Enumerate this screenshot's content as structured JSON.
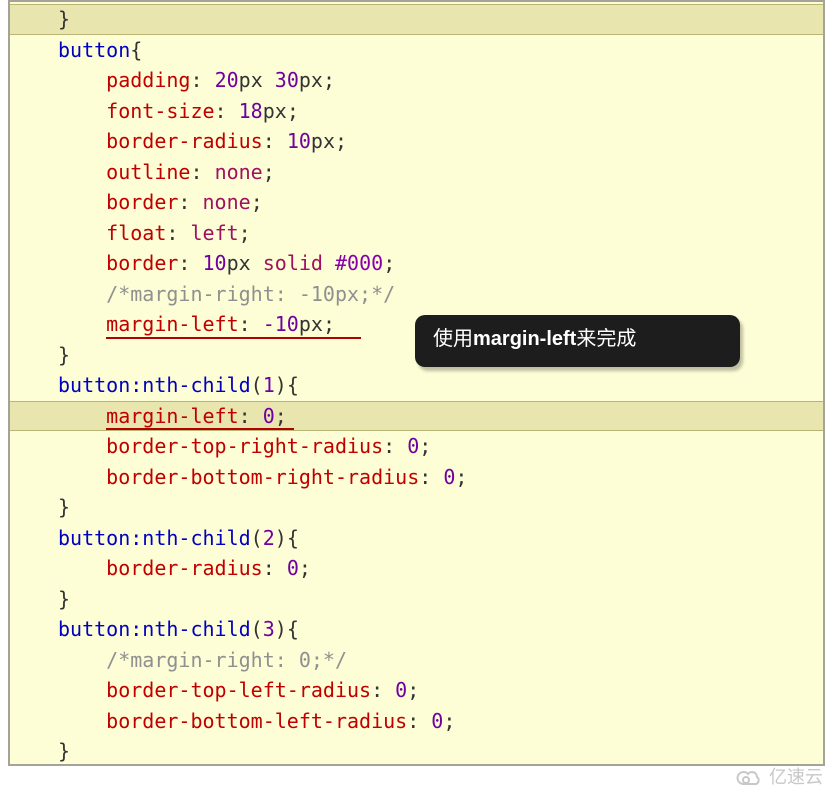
{
  "tooltip": {
    "prefix": "使用",
    "bold": "margin-left",
    "suffix": "来完成"
  },
  "watermark": "亿速云",
  "code": {
    "l0": {
      "brace": "}"
    },
    "l1": {
      "sel": "button",
      "brace": "{"
    },
    "l2": {
      "prop": "padding",
      "v1": "20",
      "u1": "px",
      "v2": "30",
      "u2": "px"
    },
    "l3": {
      "prop": "font-size",
      "v1": "18",
      "u1": "px"
    },
    "l4": {
      "prop": "border-radius",
      "v1": "10",
      "u1": "px"
    },
    "l5": {
      "prop": "outline",
      "val": "none"
    },
    "l6": {
      "prop": "border",
      "val": "none"
    },
    "l7": {
      "prop": "float",
      "val": "left"
    },
    "l8": {
      "prop": "border",
      "v1": "10",
      "u1": "px",
      "kw": "solid",
      "hex": "#000"
    },
    "l9": {
      "comment": "/*margin-right: -10px;*/"
    },
    "l10": {
      "prop": "margin-left",
      "v1": "-10",
      "u1": "px"
    },
    "l11": {
      "brace": "}"
    },
    "l12": {
      "sel": "button",
      "pseudo": ":nth-child",
      "arg": "1",
      "brace": "{"
    },
    "l13": {
      "prop": "margin-left",
      "v1": "0"
    },
    "l14": {
      "prop": "border-top-right-radius",
      "v1": "0"
    },
    "l15": {
      "prop": "border-bottom-right-radius",
      "v1": "0"
    },
    "l16": {
      "brace": "}"
    },
    "l17": {
      "sel": "button",
      "pseudo": ":nth-child",
      "arg": "2",
      "brace": "{"
    },
    "l18": {
      "prop": "border-radius",
      "v1": "0"
    },
    "l19": {
      "brace": "}"
    },
    "l20": {
      "sel": "button",
      "pseudo": ":nth-child",
      "arg": "3",
      "brace": "{"
    },
    "l21": {
      "comment": "/*margin-right: 0;*/"
    },
    "l22": {
      "prop": "border-top-left-radius",
      "v1": "0"
    },
    "l23": {
      "prop": "border-bottom-left-radius",
      "v1": "0"
    },
    "l24": {
      "brace": "}"
    }
  }
}
